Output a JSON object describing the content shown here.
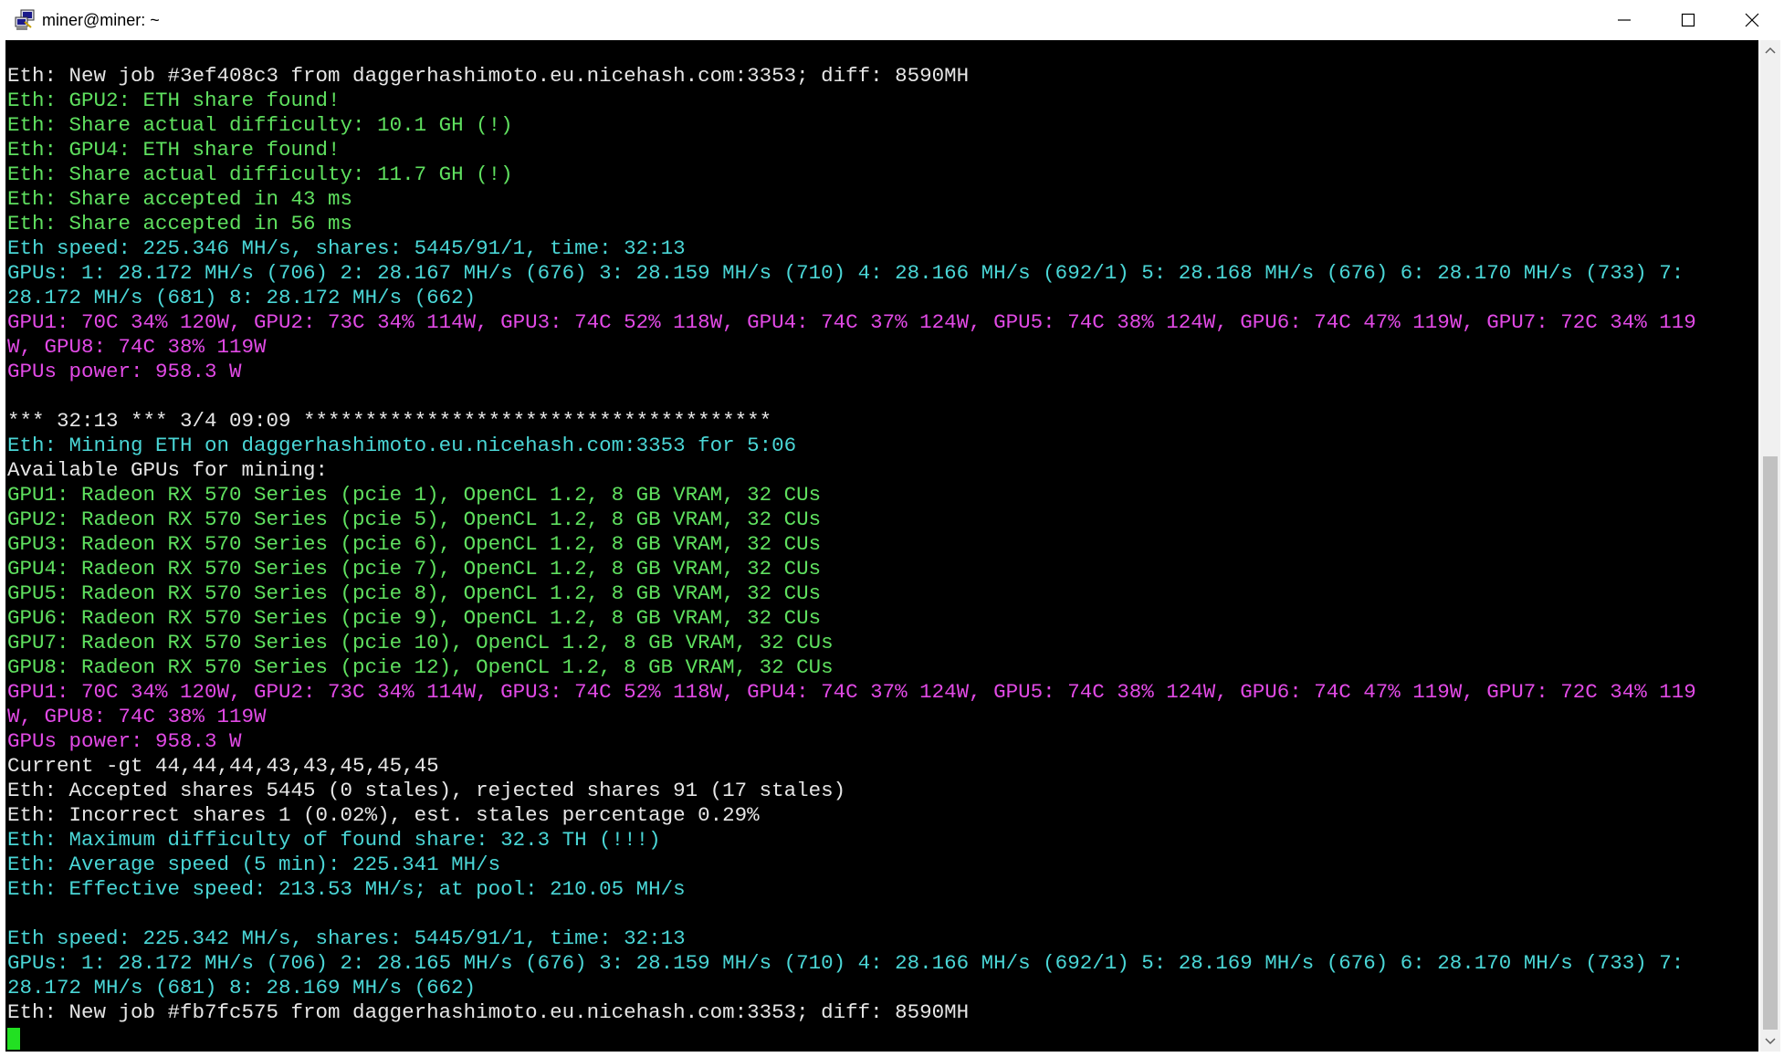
{
  "window": {
    "title": "miner@miner: ~"
  },
  "colors": {
    "white": "#e6e6e6",
    "cyan": "#4ad6d6",
    "green": "#5fe05f",
    "magenta": "#e24ae6",
    "cursor": "#22e022",
    "background": "#000000"
  },
  "terminal": {
    "lines": [
      {
        "text": "Eth: New job #3ef408c3 from daggerhashimoto.eu.nicehash.com:3353; diff: 8590MH",
        "color": "white"
      },
      {
        "text": "Eth: GPU2: ETH share found!",
        "color": "green"
      },
      {
        "text": "Eth: Share actual difficulty: 10.1 GH (!)",
        "color": "green"
      },
      {
        "text": "Eth: GPU4: ETH share found!",
        "color": "green"
      },
      {
        "text": "Eth: Share actual difficulty: 11.7 GH (!)",
        "color": "green"
      },
      {
        "text": "Eth: Share accepted in 43 ms",
        "color": "green"
      },
      {
        "text": "Eth: Share accepted in 56 ms",
        "color": "green"
      },
      {
        "text": "Eth speed: 225.346 MH/s, shares: 5445/91/1, time: 32:13",
        "color": "cyan"
      },
      {
        "text": "GPUs: 1: 28.172 MH/s (706) 2: 28.167 MH/s (676) 3: 28.159 MH/s (710) 4: 28.166 MH/s (692/1) 5: 28.168 MH/s (676) 6: 28.170 MH/s (733) 7:",
        "color": "cyan"
      },
      {
        "text": "28.172 MH/s (681) 8: 28.172 MH/s (662)",
        "color": "cyan"
      },
      {
        "text": "GPU1: 70C 34% 120W, GPU2: 73C 34% 114W, GPU3: 74C 52% 118W, GPU4: 74C 37% 124W, GPU5: 74C 38% 124W, GPU6: 74C 47% 119W, GPU7: 72C 34% 119",
        "color": "magenta"
      },
      {
        "text": "W, GPU8: 74C 38% 119W",
        "color": "magenta"
      },
      {
        "text": "GPUs power: 958.3 W",
        "color": "magenta"
      },
      {
        "text": "",
        "color": "white"
      },
      {
        "text": "*** 32:13 *** 3/4 09:09 **************************************",
        "color": "white"
      },
      {
        "text": "Eth: Mining ETH on daggerhashimoto.eu.nicehash.com:3353 for 5:06",
        "color": "cyan"
      },
      {
        "text": "Available GPUs for mining:",
        "color": "white"
      },
      {
        "text": "GPU1: Radeon RX 570 Series (pcie 1), OpenCL 1.2, 8 GB VRAM, 32 CUs",
        "color": "green"
      },
      {
        "text": "GPU2: Radeon RX 570 Series (pcie 5), OpenCL 1.2, 8 GB VRAM, 32 CUs",
        "color": "green"
      },
      {
        "text": "GPU3: Radeon RX 570 Series (pcie 6), OpenCL 1.2, 8 GB VRAM, 32 CUs",
        "color": "green"
      },
      {
        "text": "GPU4: Radeon RX 570 Series (pcie 7), OpenCL 1.2, 8 GB VRAM, 32 CUs",
        "color": "green"
      },
      {
        "text": "GPU5: Radeon RX 570 Series (pcie 8), OpenCL 1.2, 8 GB VRAM, 32 CUs",
        "color": "green"
      },
      {
        "text": "GPU6: Radeon RX 570 Series (pcie 9), OpenCL 1.2, 8 GB VRAM, 32 CUs",
        "color": "green"
      },
      {
        "text": "GPU7: Radeon RX 570 Series (pcie 10), OpenCL 1.2, 8 GB VRAM, 32 CUs",
        "color": "green"
      },
      {
        "text": "GPU8: Radeon RX 570 Series (pcie 12), OpenCL 1.2, 8 GB VRAM, 32 CUs",
        "color": "green"
      },
      {
        "text": "GPU1: 70C 34% 120W, GPU2: 73C 34% 114W, GPU3: 74C 52% 118W, GPU4: 74C 37% 124W, GPU5: 74C 38% 124W, GPU6: 74C 47% 119W, GPU7: 72C 34% 119",
        "color": "magenta"
      },
      {
        "text": "W, GPU8: 74C 38% 119W",
        "color": "magenta"
      },
      {
        "text": "GPUs power: 958.3 W",
        "color": "magenta"
      },
      {
        "text": "Current -gt 44,44,44,43,43,45,45,45",
        "color": "white"
      },
      {
        "text": "Eth: Accepted shares 5445 (0 stales), rejected shares 91 (17 stales)",
        "color": "white"
      },
      {
        "text": "Eth: Incorrect shares 1 (0.02%), est. stales percentage 0.29%",
        "color": "white"
      },
      {
        "text": "Eth: Maximum difficulty of found share: 32.3 TH (!!!)",
        "color": "cyan"
      },
      {
        "text": "Eth: Average speed (5 min): 225.341 MH/s",
        "color": "cyan"
      },
      {
        "text": "Eth: Effective speed: 213.53 MH/s; at pool: 210.05 MH/s",
        "color": "cyan"
      },
      {
        "text": "",
        "color": "white"
      },
      {
        "text": "Eth speed: 225.342 MH/s, shares: 5445/91/1, time: 32:13",
        "color": "cyan"
      },
      {
        "text": "GPUs: 1: 28.172 MH/s (706) 2: 28.165 MH/s (676) 3: 28.159 MH/s (710) 4: 28.166 MH/s (692/1) 5: 28.169 MH/s (676) 6: 28.170 MH/s (733) 7:",
        "color": "cyan"
      },
      {
        "text": "28.172 MH/s (681) 8: 28.169 MH/s (662)",
        "color": "cyan"
      },
      {
        "text": "Eth: New job #fb7fc575 from daggerhashimoto.eu.nicehash.com:3353; diff: 8590MH",
        "color": "white"
      }
    ]
  }
}
